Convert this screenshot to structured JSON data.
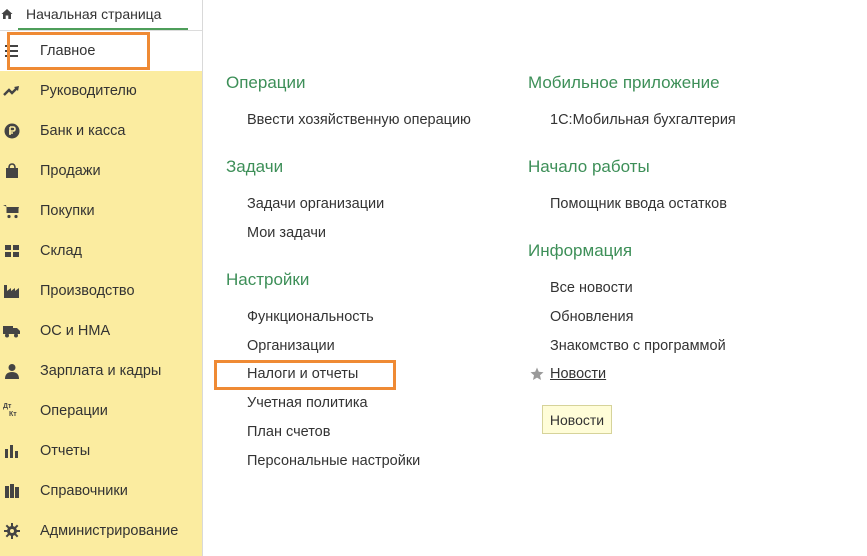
{
  "home_tab": {
    "label": "Начальная страница"
  },
  "sidebar": {
    "items": [
      {
        "label": "Главное",
        "icon": "menu-lines-icon"
      },
      {
        "label": "Руководителю",
        "icon": "trend-icon"
      },
      {
        "label": "Банк и касса",
        "icon": "ruble-coin-icon"
      },
      {
        "label": "Продажи",
        "icon": "shopping-bag-icon"
      },
      {
        "label": "Покупки",
        "icon": "cart-icon"
      },
      {
        "label": "Склад",
        "icon": "warehouse-grid-icon"
      },
      {
        "label": "Производство",
        "icon": "factory-icon"
      },
      {
        "label": "ОС и НМА",
        "icon": "truck-icon"
      },
      {
        "label": "Зарплата и кадры",
        "icon": "person-icon"
      },
      {
        "label": "Операции",
        "icon": "dt-kt-icon",
        "icon_text": [
          "Дт",
          "Кт"
        ]
      },
      {
        "label": "Отчеты",
        "icon": "bar-chart-icon"
      },
      {
        "label": "Справочники",
        "icon": "books-icon"
      },
      {
        "label": "Администрирование",
        "icon": "gear-icon"
      }
    ]
  },
  "sections": {
    "operations": {
      "title": "Операции",
      "links": [
        "Ввести хозяйственную операцию"
      ]
    },
    "tasks": {
      "title": "Задачи",
      "links": [
        "Задачи организации",
        "Мои задачи"
      ]
    },
    "settings": {
      "title": "Настройки",
      "links": [
        "Функциональность",
        "Организации",
        "Налоги и отчеты",
        "Учетная политика",
        "План счетов",
        "Персональные настройки"
      ]
    },
    "mobile": {
      "title": "Мобильное приложение",
      "links": [
        "1С:Мобильная бухгалтерия"
      ]
    },
    "start": {
      "title": "Начало работы",
      "links": [
        "Помощник ввода остатков"
      ]
    },
    "info": {
      "title": "Информация",
      "links": [
        "Все новости",
        "Обновления",
        "Знакомство с программой",
        "Новости"
      ],
      "button": "Новости"
    }
  },
  "colors": {
    "sidebar_bg": "#fbeca0",
    "section_title": "#3d8f58",
    "highlight": "#ef8a34"
  }
}
